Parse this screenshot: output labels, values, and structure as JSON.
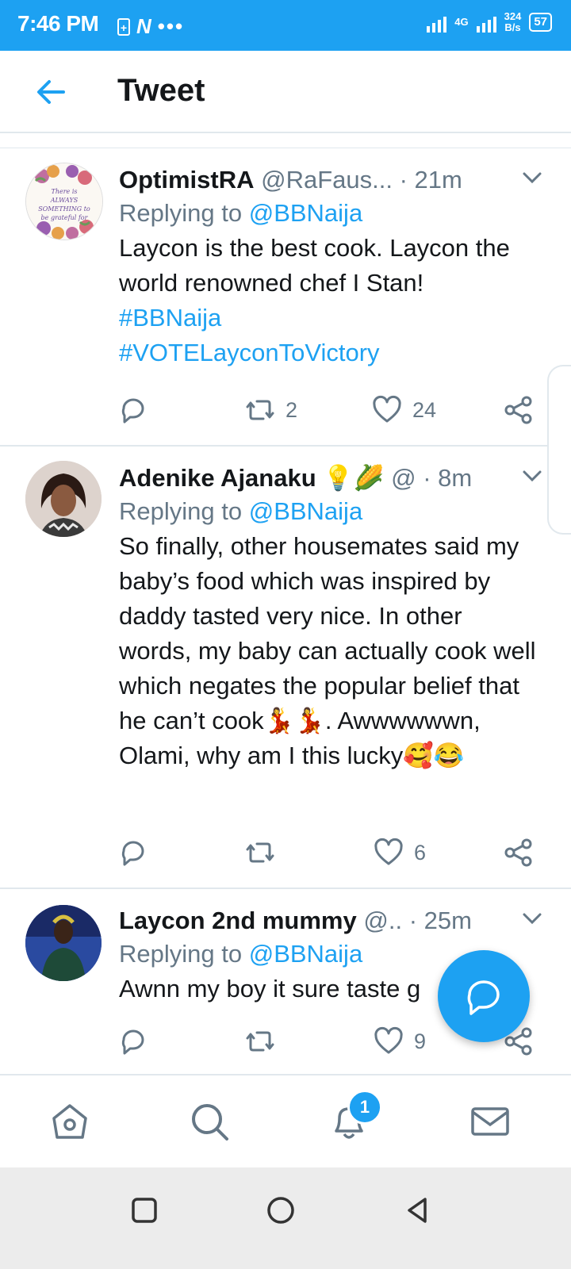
{
  "status_bar": {
    "time": "7:46 PM",
    "net_type": "4G",
    "speed_value": "324",
    "speed_unit": "B/s",
    "battery": "57"
  },
  "header": {
    "title": "Tweet"
  },
  "tweets": [
    {
      "name": "OptimistRA",
      "handle": "@RaFaus...",
      "time": "· 21m",
      "replying_prefix": "Replying to",
      "replying_to": "@BBNaija",
      "text": "Laycon is the best cook. Laycon the world renowned chef I Stan!",
      "hashtags": [
        "#BBNaija",
        "#VOTELayconToVictory"
      ],
      "retweets": "2",
      "likes": "24",
      "avatar_text": "There is ALWAYS SOMETHING to be grateful for"
    },
    {
      "name": "Adenike Ajanaku",
      "handle": "@",
      "time": "· 8m",
      "replying_prefix": "Replying to",
      "replying_to": "@BBNaija",
      "text": "So finally, other housemates said my baby’s food which was inspired by daddy tasted very nice. In other words, my baby can actually cook well which negates the popular belief that he can’t cook💃💃. Awwwwwwn, Olami, why am I this lucky🥰😂",
      "retweets": "",
      "likes": "6"
    },
    {
      "name": "Laycon 2nd mummy",
      "handle": "@..",
      "time": "· 25m",
      "replying_prefix": "Replying to",
      "replying_to": "@BBNaija",
      "text": "Awnn my boy it sure taste g",
      "retweets": "",
      "likes": "9"
    }
  ],
  "bottom_nav": {
    "notifications_badge": "1"
  },
  "colors": {
    "accent": "#1da1f2",
    "secondary_text": "#657786",
    "divider": "#e1e8ed"
  }
}
